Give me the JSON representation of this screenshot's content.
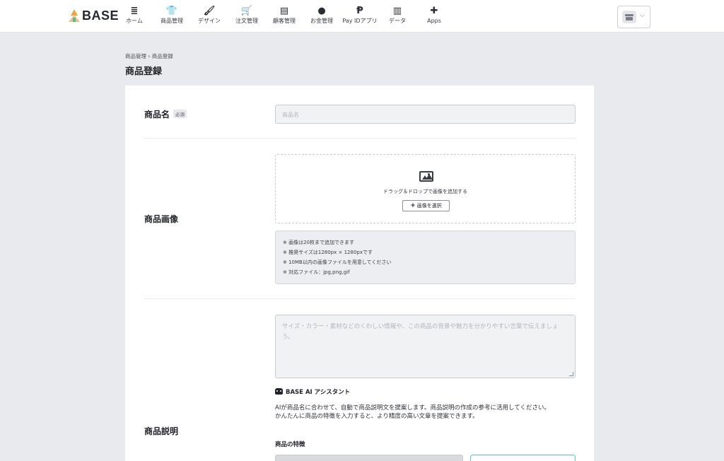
{
  "header": {
    "logo_text": "BASE",
    "nav": [
      {
        "label": "ホーム",
        "icon": "≣",
        "icon_name": "home-list-icon"
      },
      {
        "label": "商品管理",
        "icon": "👕",
        "icon_name": "tshirt-icon"
      },
      {
        "label": "デザイン",
        "icon": "🖌",
        "icon_name": "brush-icon"
      },
      {
        "label": "注文管理",
        "icon": "🛒",
        "icon_name": "cart-icon"
      },
      {
        "label": "顧客管理",
        "icon": "▤",
        "icon_name": "customer-card-icon"
      },
      {
        "label": "お金管理",
        "icon": "●",
        "icon_name": "money-bag-icon"
      },
      {
        "label": "Pay IDアプリ",
        "icon": "Ᵽ",
        "icon_name": "payid-icon"
      },
      {
        "label": "データ",
        "icon": "▥",
        "icon_name": "chart-icon"
      },
      {
        "label": "Apps",
        "icon": "✚",
        "icon_name": "puzzle-icon"
      }
    ]
  },
  "breadcrumb": {
    "parent": "商品管理",
    "separator": "›",
    "current": "商品登録"
  },
  "page_title": "商品登録",
  "form": {
    "name": {
      "label": "商品名",
      "required_badge": "必須",
      "placeholder": "商品名"
    },
    "image": {
      "label": "商品画像",
      "drop_text": "ドラッグ＆ドロップで画像を追加する",
      "select_button": "画像を選択",
      "notes": [
        "※ 画像は20枚まで追加できます",
        "※ 推奨サイズは1280px × 1280pxです",
        "※ 10MB以内の画像ファイルを用意してください",
        "※ 対応ファイル：jpg,png,gif"
      ]
    },
    "description": {
      "label": "商品説明",
      "placeholder": "サイズ・カラー・素材などのくわしい情報や、この商品の背景や魅力を分かりやすい言葉で伝えましょう。",
      "ai_title": "BASE AI アシスタント",
      "ai_desc_line1": "AIが商品名に合わせて、自動で商品説明文を提案します。商品説明の作成の参考に活用してください。",
      "ai_desc_line2": "かんたんに商品の特徴を入力すると、より精度の高い文章を提案できます。",
      "feature_label": "商品の特徴"
    }
  }
}
